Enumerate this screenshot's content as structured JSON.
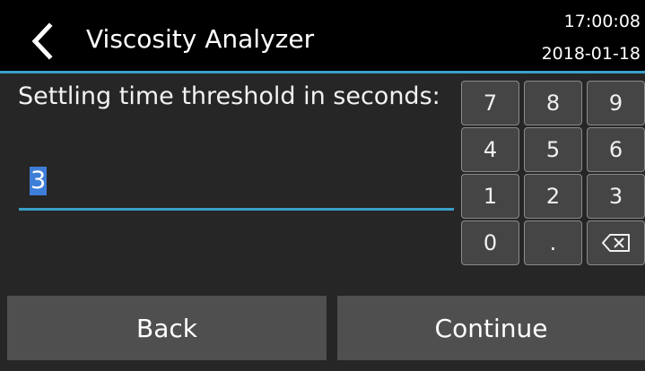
{
  "header": {
    "back_icon": "chevron-left-icon",
    "title": "Viscosity Analyzer",
    "time": "17:00:08",
    "date": "2018-01-18"
  },
  "prompt": {
    "label": "Settling time threshold in seconds:",
    "value": "3"
  },
  "keypad": {
    "keys": [
      "7",
      "8",
      "9",
      "4",
      "5",
      "6",
      "1",
      "2",
      "3",
      "0",
      "."
    ],
    "backspace_icon": "backspace-icon"
  },
  "footer": {
    "back_label": "Back",
    "continue_label": "Continue"
  },
  "colors": {
    "accent": "#3a9fc8",
    "selection": "#3e7ed8",
    "background": "#262626",
    "header_background": "#000000",
    "key_background": "#454545",
    "button_background": "#4f4f4f"
  }
}
